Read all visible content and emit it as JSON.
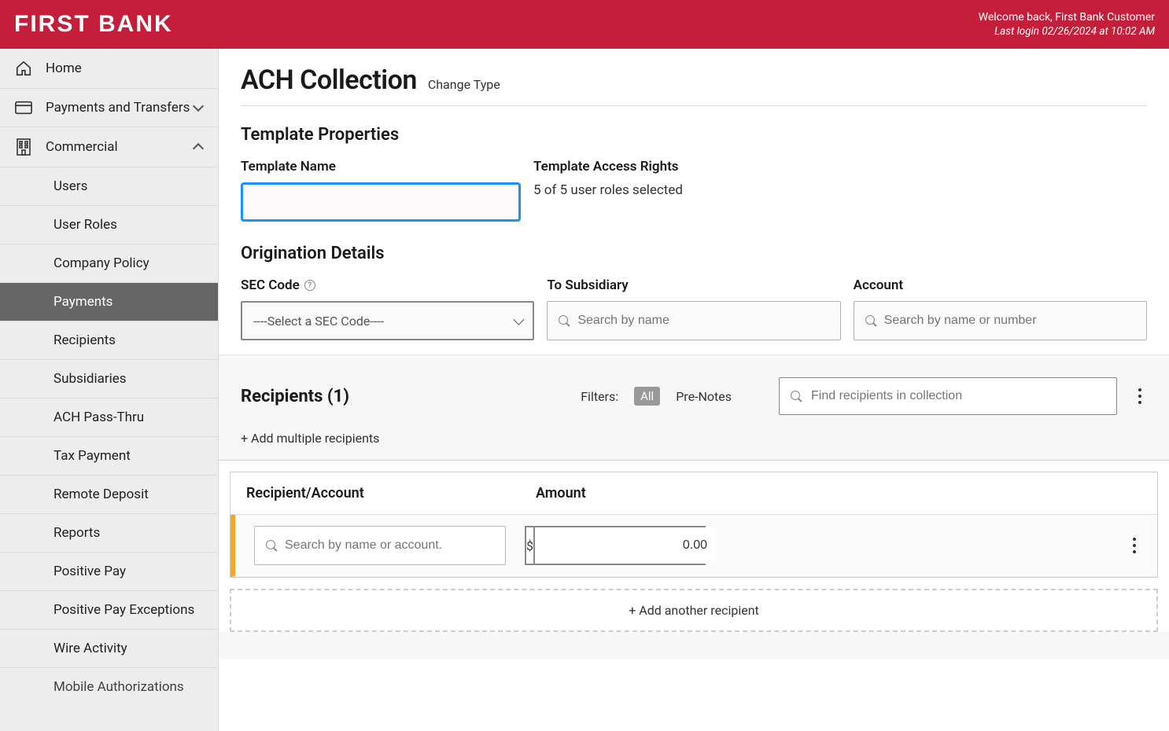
{
  "header": {
    "logo": "FIRST BANK",
    "welcome": "Welcome back, First Bank Customer",
    "last_login": "Last login 02/26/2024 at 10:02 AM"
  },
  "sidebar": {
    "home": "Home",
    "payments_transfers": "Payments and Transfers",
    "commercial": "Commercial",
    "sub": {
      "users": "Users",
      "user_roles": "User Roles",
      "company_policy": "Company Policy",
      "payments": "Payments",
      "recipients": "Recipients",
      "subsidiaries": "Subsidiaries",
      "ach_pass_thru": "ACH Pass-Thru",
      "tax_payment": "Tax Payment",
      "remote_deposit": "Remote Deposit",
      "reports": "Reports",
      "positive_pay": "Positive Pay",
      "positive_pay_exceptions": "Positive Pay Exceptions",
      "wire_activity": "Wire Activity",
      "mobile_auth": "Mobile Authorizations"
    }
  },
  "page": {
    "title": "ACH Collection",
    "change_type": "Change Type",
    "template_properties": "Template Properties",
    "template_name_label": "Template Name",
    "template_name_value": "",
    "access_rights_label": "Template Access Rights",
    "access_rights_value": "5 of 5 user roles selected",
    "origination_details": "Origination Details",
    "sec_code_label": "SEC Code",
    "sec_code_placeholder": "----Select a SEC Code----",
    "to_subsidiary_label": "To Subsidiary",
    "to_subsidiary_placeholder": "Search by name",
    "account_label": "Account",
    "account_placeholder": "Search by name or number"
  },
  "recipients": {
    "title": "Recipients (1)",
    "filters_label": "Filters:",
    "filter_all": "All",
    "filter_prenotes": "Pre-Notes",
    "search_placeholder": "Find recipients in collection",
    "add_multiple": "+ Add multiple recipients",
    "col_recipient": "Recipient/Account",
    "col_amount": "Amount",
    "row_search_placeholder": "Search by name or account.",
    "amount_prefix": "$",
    "amount_value": "0.00",
    "add_another": "+ Add another recipient"
  }
}
